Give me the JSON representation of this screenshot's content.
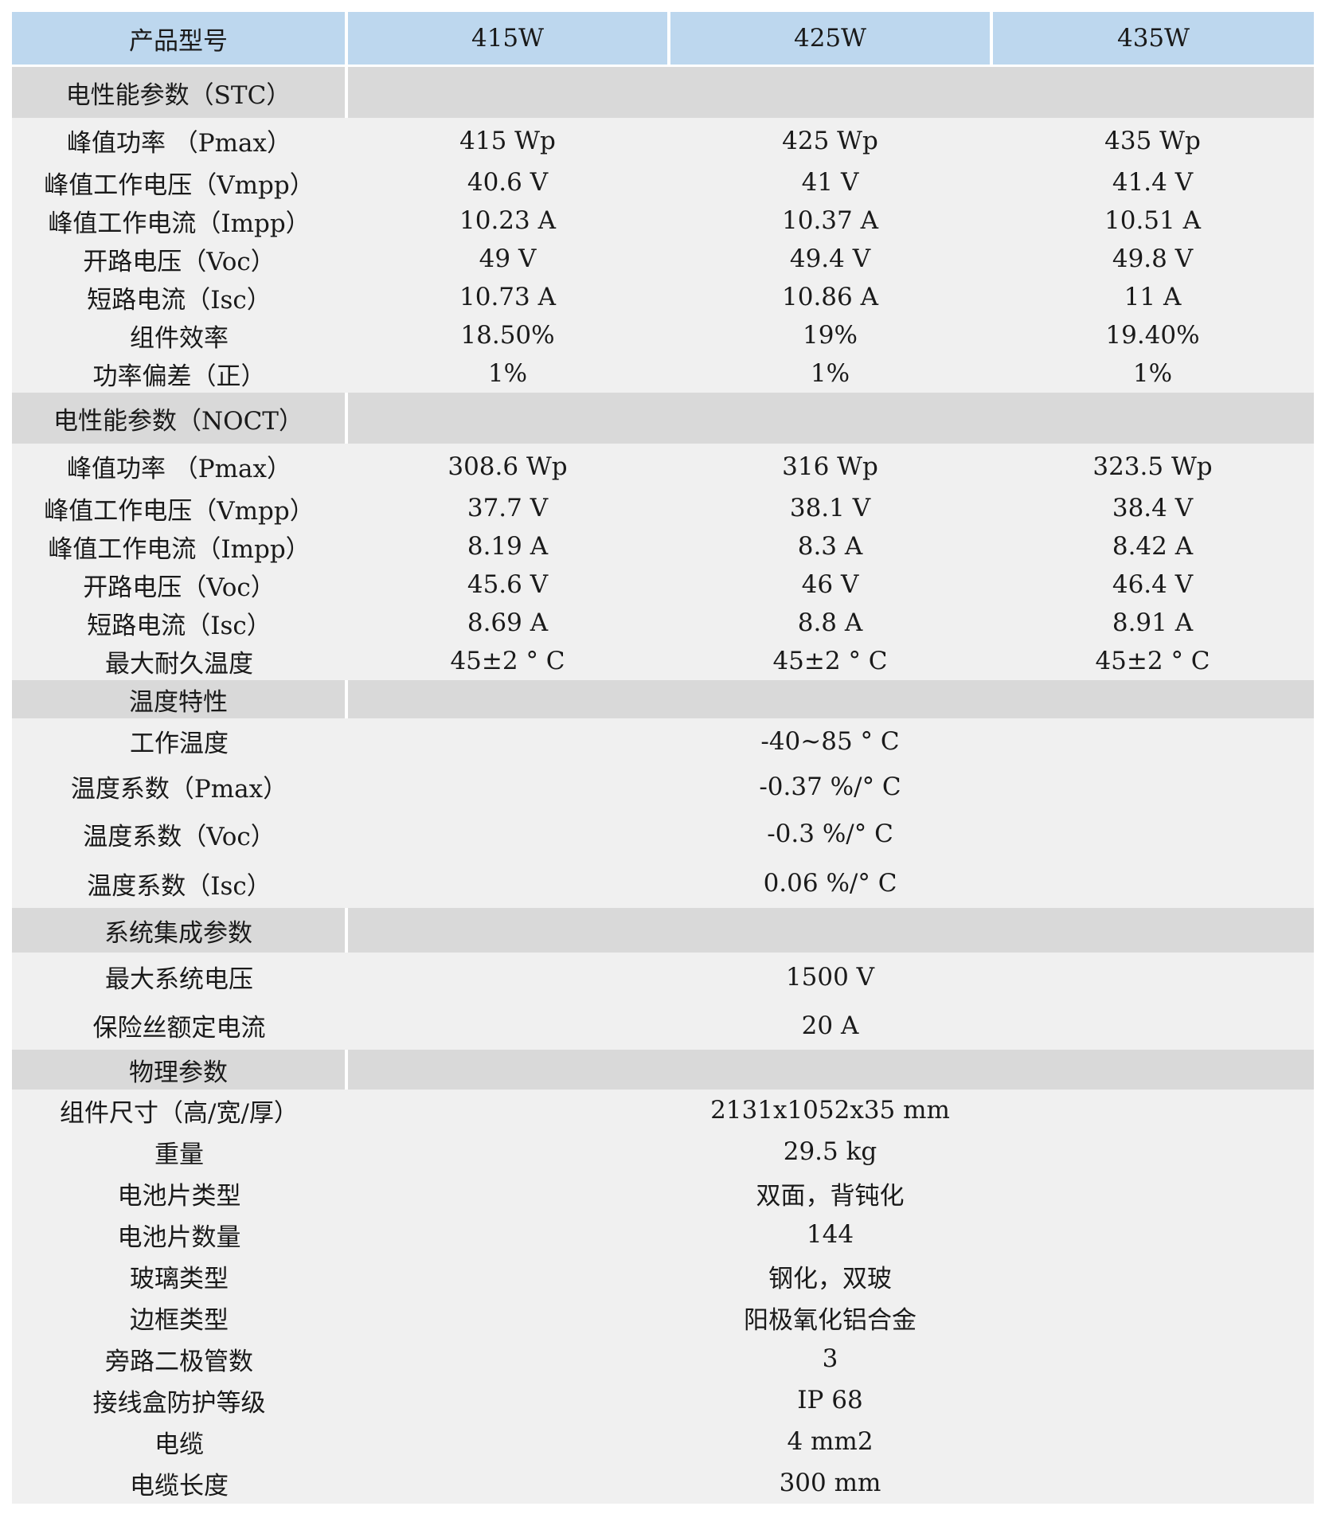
{
  "header": {
    "label": "产品型号",
    "models": [
      "415W",
      "425W",
      "435W"
    ]
  },
  "stc": {
    "title": "电性能参数（STC）",
    "rows": [
      {
        "label": "峰值功率 （Pmax）",
        "values": [
          "415 Wp",
          "425 Wp",
          "435 Wp"
        ]
      },
      {
        "label": "峰值工作电压（Vmpp）",
        "values": [
          "40.6 V",
          "41 V",
          "41.4 V"
        ]
      },
      {
        "label": "峰值工作电流（Impp）",
        "values": [
          "10.23 A",
          "10.37 A",
          "10.51 A"
        ]
      },
      {
        "label": "开路电压（Voc）",
        "values": [
          "49 V",
          "49.4 V",
          "49.8 V"
        ]
      },
      {
        "label": "短路电流（Isc）",
        "values": [
          "10.73 A",
          "10.86 A",
          "11 A"
        ]
      },
      {
        "label": "组件效率",
        "values": [
          "18.50%",
          "19%",
          "19.40%"
        ]
      },
      {
        "label": "功率偏差（正）",
        "values": [
          "1%",
          "1%",
          "1%"
        ]
      }
    ]
  },
  "noct": {
    "title": "电性能参数（NOCT）",
    "rows": [
      {
        "label": "峰值功率 （Pmax）",
        "values": [
          "308.6 Wp",
          "316 Wp",
          "323.5 Wp"
        ]
      },
      {
        "label": "峰值工作电压（Vmpp）",
        "values": [
          "37.7 V",
          "38.1 V",
          "38.4 V"
        ]
      },
      {
        "label": "峰值工作电流（Impp）",
        "values": [
          "8.19 A",
          "8.3 A",
          "8.42 A"
        ]
      },
      {
        "label": "开路电压（Voc）",
        "values": [
          "45.6 V",
          "46 V",
          "46.4 V"
        ]
      },
      {
        "label": "短路电流（Isc）",
        "values": [
          "8.69 A",
          "8.8 A",
          "8.91 A"
        ]
      },
      {
        "label": "最大耐久温度",
        "values": [
          "45±2 ° C",
          "45±2 ° C",
          "45±2 ° C"
        ]
      }
    ]
  },
  "temperature": {
    "title": "温度特性",
    "rows": [
      {
        "label": "工作温度",
        "value": "-40~85 ° C"
      },
      {
        "label": "温度系数（Pmax）",
        "value": "-0.37 %/° C"
      },
      {
        "label": "温度系数（Voc）",
        "value": "-0.3 %/° C"
      },
      {
        "label": "温度系数（Isc）",
        "value": "0.06 %/° C"
      }
    ]
  },
  "system": {
    "title": "系统集成参数",
    "rows": [
      {
        "label": "最大系统电压",
        "value": "1500 V"
      },
      {
        "label": "保险丝额定电流",
        "value": "20 A"
      }
    ]
  },
  "physical": {
    "title": "物理参数",
    "rows": [
      {
        "label": "组件尺寸（高/宽/厚）",
        "value": "2131x1052x35 mm"
      },
      {
        "label": "重量",
        "value": "29.5 kg"
      },
      {
        "label": "电池片类型",
        "value": "双面，背钝化"
      },
      {
        "label": "电池片数量",
        "value": "144"
      },
      {
        "label": "玻璃类型",
        "value": "钢化，双玻"
      },
      {
        "label": "边框类型",
        "value": "阳极氧化铝合金"
      },
      {
        "label": "旁路二极管数",
        "value": "3"
      },
      {
        "label": "接线盒防护等级",
        "value": "IP 68"
      },
      {
        "label": "电缆",
        "value": "4 mm2"
      },
      {
        "label": "电缆长度",
        "value": "300 mm"
      }
    ]
  }
}
